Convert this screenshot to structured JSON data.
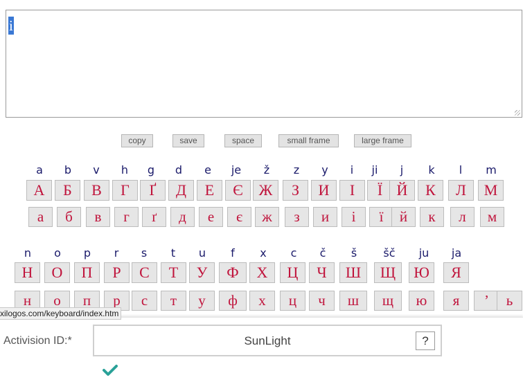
{
  "editor": {
    "selected_text": "і"
  },
  "controls": [
    {
      "id": "copy",
      "label": "copy"
    },
    {
      "id": "save",
      "label": "save"
    },
    {
      "id": "space",
      "label": "space"
    },
    {
      "id": "small",
      "label": "small frame"
    },
    {
      "id": "large",
      "label": "large frame"
    }
  ],
  "row1": {
    "latin": [
      "a",
      "b",
      "v",
      "h",
      "g",
      "d",
      "e",
      "je",
      "ž",
      "z",
      "y",
      "i",
      "ji",
      "j",
      "k",
      "l",
      "m"
    ],
    "upper": [
      "А",
      "Б",
      "В",
      "Г",
      "Ґ",
      "Д",
      "Е",
      "Є",
      "Ж",
      "З",
      "И",
      "І",
      "Ї",
      "Й",
      "К",
      "Л",
      "М"
    ],
    "lower": [
      "а",
      "б",
      "в",
      "г",
      "ґ",
      "д",
      "е",
      "є",
      "ж",
      "з",
      "и",
      "і",
      "ї",
      "й",
      "к",
      "л",
      "м"
    ]
  },
  "row2": {
    "latin": [
      "n",
      "o",
      "p",
      "r",
      "s",
      "t",
      "u",
      "f",
      "x",
      "c",
      "č",
      "š",
      "šč",
      "ju",
      "ja"
    ],
    "upper": [
      "Н",
      "О",
      "П",
      "Р",
      "С",
      "Т",
      "У",
      "Ф",
      "Х",
      "Ц",
      "Ч",
      "Ш",
      "Щ",
      "Ю",
      "Я"
    ],
    "lower": [
      "н",
      "о",
      "п",
      "р",
      "с",
      "т",
      "у",
      "ф",
      "х",
      "ц",
      "ч",
      "ш",
      "щ",
      "ю",
      "я",
      "’",
      "ь"
    ]
  },
  "status_url": "xilogos.com/keyboard/index.htm",
  "activision": {
    "label": "Activision ID:*",
    "value": "SunLight",
    "help": "?"
  },
  "icons": {
    "check": "check-icon",
    "check_color": "#2aa198",
    "key_text_color": "#c0143c"
  }
}
